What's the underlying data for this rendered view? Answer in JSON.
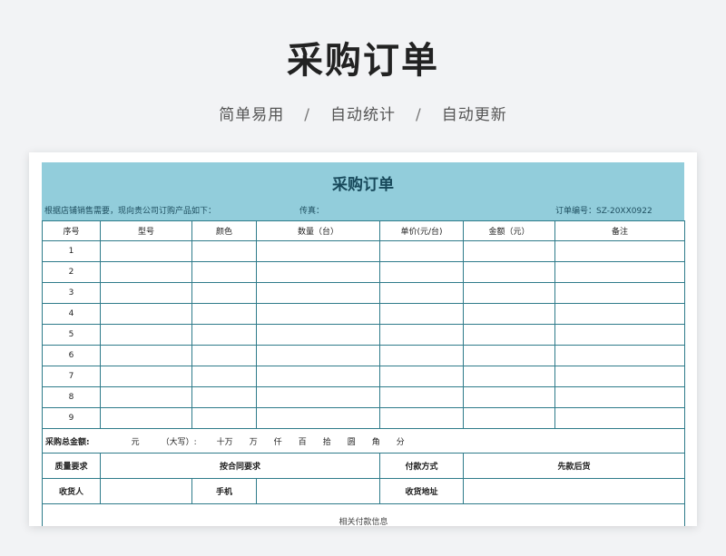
{
  "page": {
    "title": "采购订单",
    "subtitle_items": [
      "简单易用",
      "自动统计",
      "自动更新"
    ],
    "subtitle_sep": "/"
  },
  "order": {
    "title": "采购订单",
    "intro": "根据店铺销售需要，现向贵公司订购产品如下：",
    "fax_label": "传真：",
    "order_no_label": "订单编号：",
    "order_no": "SZ-20XX0922",
    "columns": [
      "序号",
      "型号",
      "颜色",
      "数量（台）",
      "单价(元/台)",
      "金额（元）",
      "备注"
    ],
    "rows": [
      "1",
      "2",
      "3",
      "4",
      "5",
      "6",
      "7",
      "8",
      "9"
    ],
    "total": {
      "label": "采购总金额:",
      "yuan": "元",
      "capital": "（大写）:",
      "units": [
        "十万",
        "万",
        "仟",
        "百",
        "拾",
        "圆",
        "角",
        "分"
      ]
    },
    "quality_label": "质量要求",
    "quality_value": "按合同要求",
    "payment_label": "付款方式",
    "payment_value": "先款后货",
    "receiver_label": "收货人",
    "phone_label": "手机",
    "address_label": "收货地址",
    "cutoff_text": "相关付款信息"
  },
  "colors": {
    "background": "#f2f3f5",
    "header_band": "#92cddb",
    "grid_line": "#2e7b8a",
    "order_title": "#17485a"
  }
}
